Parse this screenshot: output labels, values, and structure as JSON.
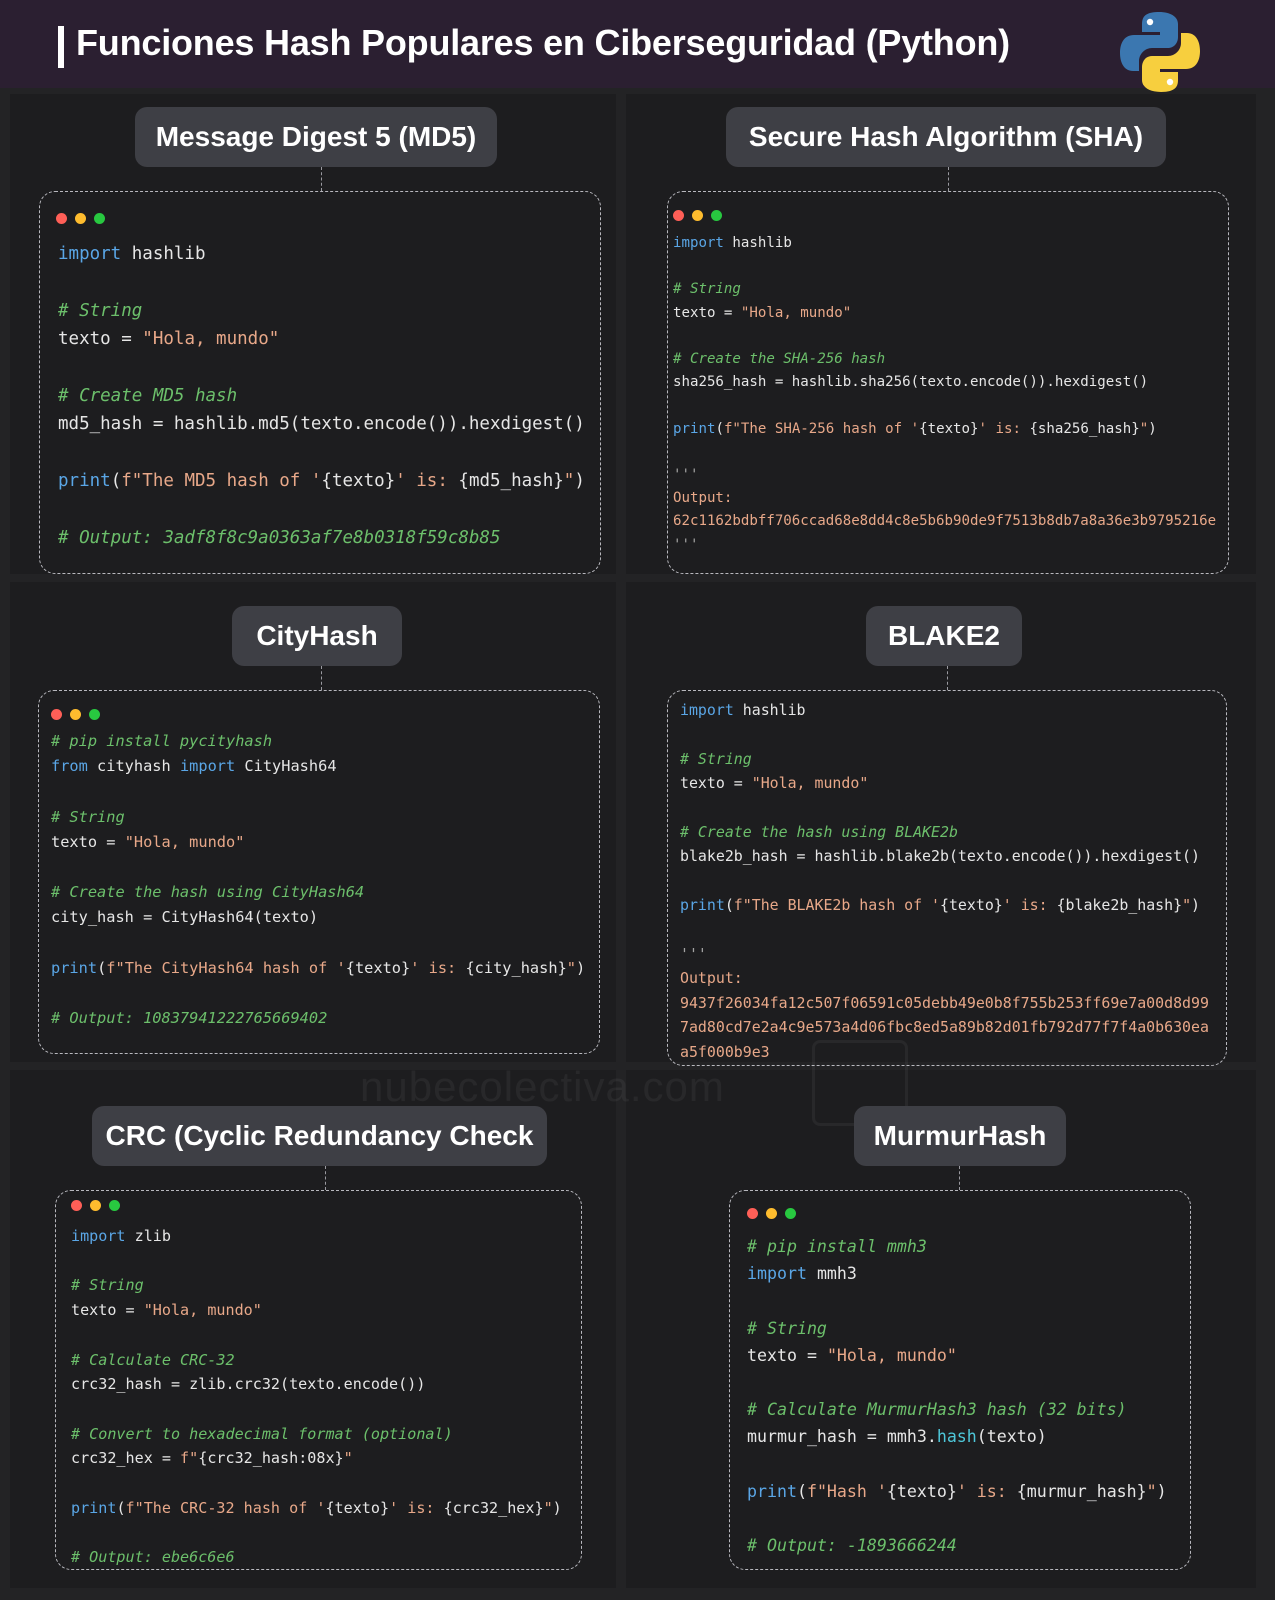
{
  "header": {
    "title": "Funciones Hash Populares en Ciberseguridad (Python)",
    "logo_icon": "python-logo-icon"
  },
  "watermark": "nubecolectiva.com",
  "colors": {
    "keyword": "#5aa6e6",
    "comment": "#6cbf6b",
    "string": "#e8a889",
    "function": "#4ec7d9",
    "header_bg": "#2b1f31",
    "pill_bg": "#3e3f45"
  },
  "cards": {
    "md5": {
      "title": "Message Digest 5 (MD5)",
      "lines": [
        {
          "p": [
            {
              "t": "import",
              "c": "kw"
            },
            {
              "t": " hashlib"
            }
          ]
        },
        {
          "p": []
        },
        {
          "p": [
            {
              "t": "# String",
              "c": "cm"
            }
          ]
        },
        {
          "p": [
            {
              "t": "texto = "
            },
            {
              "t": "\"Hola, mundo\"",
              "c": "st"
            }
          ]
        },
        {
          "p": []
        },
        {
          "p": [
            {
              "t": "# Create MD5 hash",
              "c": "cm"
            }
          ]
        },
        {
          "p": [
            {
              "t": "md5_hash = hashlib.md5(texto.encode()).hexdigest()"
            }
          ]
        },
        {
          "p": []
        },
        {
          "p": [
            {
              "t": "print",
              "c": "kw"
            },
            {
              "t": "("
            },
            {
              "t": "f\"The MD5 hash of '",
              "c": "st"
            },
            {
              "t": "{texto}"
            },
            {
              "t": "' is: ",
              "c": "st"
            },
            {
              "t": "{md5_hash}"
            },
            {
              "t": "\"",
              "c": "st"
            },
            {
              "t": ")"
            }
          ]
        },
        {
          "p": []
        },
        {
          "p": [
            {
              "t": "# Output: 3adf8f8c9a0363af7e8b0318f59c8b85",
              "c": "cm"
            }
          ]
        }
      ]
    },
    "sha": {
      "title": "Secure Hash Algorithm (SHA)",
      "lines": [
        {
          "p": [
            {
              "t": "import",
              "c": "kw"
            },
            {
              "t": " hashlib"
            }
          ]
        },
        {
          "p": []
        },
        {
          "p": [
            {
              "t": "# String",
              "c": "cm"
            }
          ]
        },
        {
          "p": [
            {
              "t": "texto = "
            },
            {
              "t": "\"Hola, mundo\"",
              "c": "st"
            }
          ]
        },
        {
          "p": []
        },
        {
          "p": [
            {
              "t": "# Create the SHA-256 hash",
              "c": "cm"
            }
          ]
        },
        {
          "p": [
            {
              "t": "sha256_hash = hashlib.sha256(texto.encode()).hexdigest()"
            }
          ]
        },
        {
          "p": []
        },
        {
          "p": [
            {
              "t": "print",
              "c": "kw"
            },
            {
              "t": "("
            },
            {
              "t": "f\"The SHA-256 hash of '",
              "c": "st"
            },
            {
              "t": "{texto}"
            },
            {
              "t": "' is: ",
              "c": "st"
            },
            {
              "t": "{sha256_hash}"
            },
            {
              "t": "\"",
              "c": "st"
            },
            {
              "t": ")"
            }
          ]
        },
        {
          "p": []
        },
        {
          "p": [
            {
              "t": "'''",
              "c": "dim"
            }
          ]
        },
        {
          "p": [
            {
              "t": "Output:",
              "c": "out"
            }
          ]
        },
        {
          "p": [
            {
              "t": "62c1162bdbff706ccad68e8dd4c8e5b6b90de9f7513b8db7a8a36e3b9795216e",
              "c": "out"
            }
          ]
        },
        {
          "p": [
            {
              "t": "'''",
              "c": "dim"
            }
          ]
        }
      ]
    },
    "cityhash": {
      "title": "CityHash",
      "lines": [
        {
          "p": [
            {
              "t": "# pip install pycityhash",
              "c": "cm"
            }
          ]
        },
        {
          "p": [
            {
              "t": "from",
              "c": "kw"
            },
            {
              "t": " cityhash "
            },
            {
              "t": "import",
              "c": "kw"
            },
            {
              "t": " CityHash64"
            }
          ]
        },
        {
          "p": []
        },
        {
          "p": [
            {
              "t": "# String",
              "c": "cm"
            }
          ]
        },
        {
          "p": [
            {
              "t": "texto = "
            },
            {
              "t": "\"Hola, mundo\"",
              "c": "st"
            }
          ]
        },
        {
          "p": []
        },
        {
          "p": [
            {
              "t": "# Create the hash using CityHash64",
              "c": "cm"
            }
          ]
        },
        {
          "p": [
            {
              "t": "city_hash = CityHash64(texto)"
            }
          ]
        },
        {
          "p": []
        },
        {
          "p": [
            {
              "t": "print",
              "c": "kw"
            },
            {
              "t": "("
            },
            {
              "t": "f\"The CityHash64 hash of '",
              "c": "st"
            },
            {
              "t": "{texto}"
            },
            {
              "t": "' is: ",
              "c": "st"
            },
            {
              "t": "{city_hash}"
            },
            {
              "t": "\"",
              "c": "st"
            },
            {
              "t": ")"
            }
          ]
        },
        {
          "p": []
        },
        {
          "p": [
            {
              "t": "# Output: 10837941222765669402",
              "c": "cm"
            }
          ]
        }
      ]
    },
    "blake2": {
      "title": "BLAKE2",
      "lines": [
        {
          "p": [
            {
              "t": "import",
              "c": "kw"
            },
            {
              "t": " hashlib"
            }
          ]
        },
        {
          "p": []
        },
        {
          "p": [
            {
              "t": "# String",
              "c": "cm"
            }
          ]
        },
        {
          "p": [
            {
              "t": "texto = "
            },
            {
              "t": "\"Hola, mundo\"",
              "c": "st"
            }
          ]
        },
        {
          "p": []
        },
        {
          "p": [
            {
              "t": "# Create the hash using BLAKE2b",
              "c": "cm"
            }
          ]
        },
        {
          "p": [
            {
              "t": "blake2b_hash = hashlib.blake2b(texto.encode()).hexdigest()"
            }
          ]
        },
        {
          "p": []
        },
        {
          "p": [
            {
              "t": "print",
              "c": "kw"
            },
            {
              "t": "("
            },
            {
              "t": "f\"The BLAKE2b hash of '",
              "c": "st"
            },
            {
              "t": "{texto}"
            },
            {
              "t": "' is: ",
              "c": "st"
            },
            {
              "t": "{blake2b_hash}"
            },
            {
              "t": "\"",
              "c": "st"
            },
            {
              "t": ")"
            }
          ]
        },
        {
          "p": []
        },
        {
          "p": [
            {
              "t": "'''",
              "c": "dim"
            }
          ]
        },
        {
          "p": [
            {
              "t": "Output:",
              "c": "out"
            }
          ]
        },
        {
          "p": [
            {
              "t": "9437f26034fa12c507f06591c05debb49e0b8f755b253ff69e7a00d8d99",
              "c": "out"
            }
          ]
        },
        {
          "p": [
            {
              "t": "7ad80cd7e2a4c9e573a4d06fbc8ed5a89b82d01fb792d77f7f4a0b630ea",
              "c": "out"
            }
          ]
        },
        {
          "p": [
            {
              "t": "a5f000b9e3",
              "c": "out"
            }
          ]
        }
      ]
    },
    "crc": {
      "title": "CRC (Cyclic Redundancy Check",
      "lines": [
        {
          "p": [
            {
              "t": "import",
              "c": "kw"
            },
            {
              "t": " zlib"
            }
          ]
        },
        {
          "p": []
        },
        {
          "p": [
            {
              "t": "# String",
              "c": "cm"
            }
          ]
        },
        {
          "p": [
            {
              "t": "texto = "
            },
            {
              "t": "\"Hola, mundo\"",
              "c": "st"
            }
          ]
        },
        {
          "p": []
        },
        {
          "p": [
            {
              "t": "# Calculate CRC-32",
              "c": "cm"
            }
          ]
        },
        {
          "p": [
            {
              "t": "crc32_hash = zlib.crc32(texto.encode())"
            }
          ]
        },
        {
          "p": []
        },
        {
          "p": [
            {
              "t": "# Convert to hexadecimal format (optional)",
              "c": "cm"
            }
          ]
        },
        {
          "p": [
            {
              "t": "crc32_hex = "
            },
            {
              "t": "f\"",
              "c": "st"
            },
            {
              "t": "{crc32_hash:08x}"
            },
            {
              "t": "\"",
              "c": "st"
            }
          ]
        },
        {
          "p": []
        },
        {
          "p": [
            {
              "t": "print",
              "c": "kw"
            },
            {
              "t": "("
            },
            {
              "t": "f\"The CRC-32 hash of '",
              "c": "st"
            },
            {
              "t": "{texto}"
            },
            {
              "t": "' is: ",
              "c": "st"
            },
            {
              "t": "{crc32_hex}"
            },
            {
              "t": "\"",
              "c": "st"
            },
            {
              "t": ")"
            }
          ]
        },
        {
          "p": []
        },
        {
          "p": [
            {
              "t": "# Output: ebe6c6e6",
              "c": "cm"
            }
          ]
        }
      ]
    },
    "murmur": {
      "title": "MurmurHash",
      "lines": [
        {
          "p": [
            {
              "t": "# pip install mmh3",
              "c": "cm"
            }
          ]
        },
        {
          "p": [
            {
              "t": "import",
              "c": "kw"
            },
            {
              "t": " mmh3"
            }
          ]
        },
        {
          "p": []
        },
        {
          "p": [
            {
              "t": "# String",
              "c": "cm"
            }
          ]
        },
        {
          "p": [
            {
              "t": "texto = "
            },
            {
              "t": "\"Hola, mundo\"",
              "c": "st"
            }
          ]
        },
        {
          "p": []
        },
        {
          "p": [
            {
              "t": "# Calculate MurmurHash3 hash (32 bits)",
              "c": "cm"
            }
          ]
        },
        {
          "p": [
            {
              "t": "murmur_hash = mmh3."
            },
            {
              "t": "hash",
              "c": "fn"
            },
            {
              "t": "(texto)"
            }
          ]
        },
        {
          "p": []
        },
        {
          "p": [
            {
              "t": "print",
              "c": "kw"
            },
            {
              "t": "("
            },
            {
              "t": "f\"Hash '",
              "c": "st"
            },
            {
              "t": "{texto}"
            },
            {
              "t": "' is: ",
              "c": "st"
            },
            {
              "t": "{murmur_hash}"
            },
            {
              "t": "\"",
              "c": "st"
            },
            {
              "t": ")"
            }
          ]
        },
        {
          "p": []
        },
        {
          "p": [
            {
              "t": "# Output: -1893666244",
              "c": "cm"
            }
          ]
        }
      ]
    }
  }
}
